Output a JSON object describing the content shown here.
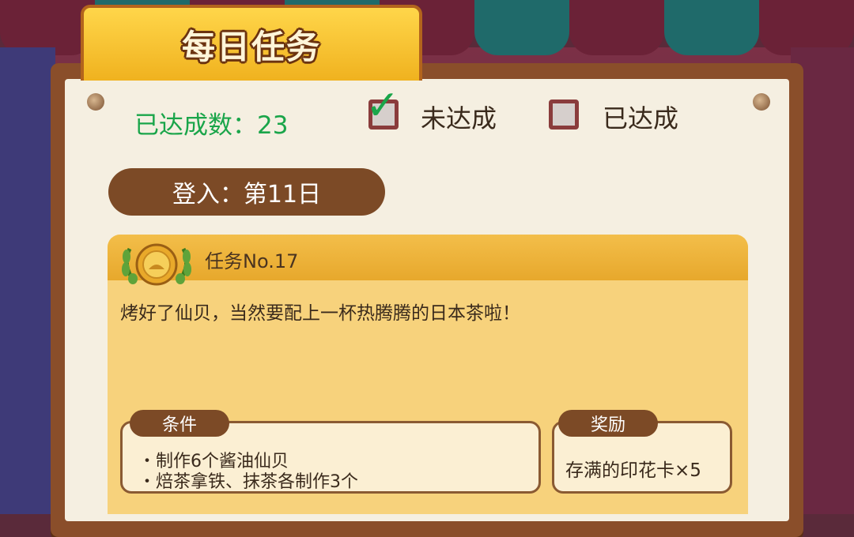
{
  "header": {
    "title": "每日任务"
  },
  "status": {
    "completed_count_label": "已达成数：23"
  },
  "legend": {
    "incomplete_label": "未达成",
    "complete_label": "已达成"
  },
  "login": {
    "label": "登入：第11日"
  },
  "task": {
    "number_label": "任务No.17",
    "description": "烤好了仙贝，当然要配上一杯热腾腾的日本茶啦！",
    "conditions_title": "条件",
    "conditions": [
      "・制作6个酱油仙贝",
      "・焙茶拿铁、抹茶各制作3个"
    ],
    "reward_title": "奖励",
    "reward": "存满的印花卡×5"
  },
  "icons": {
    "check": "check-icon",
    "medal": "laurel-medal-icon"
  },
  "colors": {
    "accent_green": "#1aa54a",
    "title_yellow": "#f0b21f",
    "brown": "#7c4a26",
    "card": "#f7d27c"
  }
}
